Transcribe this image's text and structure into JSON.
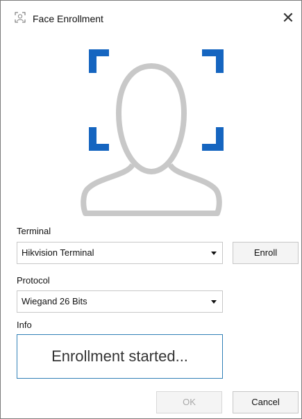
{
  "window": {
    "title": "Face Enrollment",
    "close_label": "✕"
  },
  "colors": {
    "accent_bracket": "#1565c0",
    "face_outline": "#c8c8c8",
    "info_border": "#2f7fb6"
  },
  "icons": {
    "title": "face-scan-icon",
    "close": "close-icon",
    "face": "person-silhouette-icon",
    "dropdown": "chevron-down-icon"
  },
  "terminal": {
    "label": "Terminal",
    "selected": "Hikvision Terminal",
    "enroll_label": "Enroll"
  },
  "protocol": {
    "label": "Protocol",
    "selected": "Wiegand 26 Bits"
  },
  "info": {
    "label": "Info",
    "message": "Enrollment started..."
  },
  "footer": {
    "ok_label": "OK",
    "cancel_label": "Cancel"
  }
}
